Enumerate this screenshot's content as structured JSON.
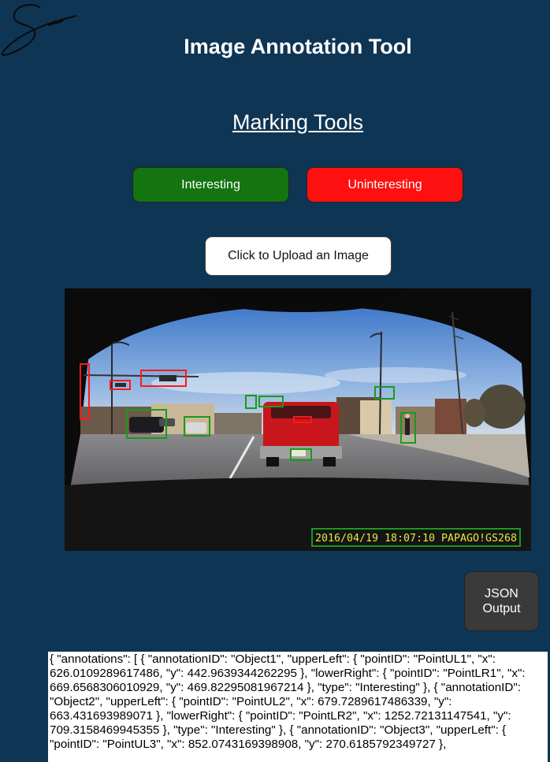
{
  "app": {
    "title": "Image Annotation Tool"
  },
  "tools": {
    "heading": "Marking Tools",
    "interesting_label": "Interesting",
    "uninteresting_label": "Uninteresting",
    "interesting_color": "#137411",
    "uninteresting_color": "#fe1010"
  },
  "upload": {
    "label": "Click to Upload an Image"
  },
  "image": {
    "timestamp": "2016/04/19 18:07:10 PAPAGO!GS268",
    "annotation_types": [
      "Interesting",
      "Uninteresting"
    ]
  },
  "json_button": {
    "label": "JSON\nOutput"
  },
  "json_output": {
    "text": "{ \"annotations\": [ { \"annotationID\": \"Object1\", \"upperLeft\": { \"pointID\": \"PointUL1\", \"x\": 626.0109289617486, \"y\": 442.9639344262295 }, \"lowerRight\": { \"pointID\": \"PointLR1\", \"x\": 669.6568306010929, \"y\": 469.82295081967214 }, \"type\": \"Interesting\" }, { \"annotationID\": \"Object2\", \"upperLeft\": { \"pointID\": \"PointUL2\", \"x\": 679.7289617486339, \"y\": 663.431693989071 }, \"lowerRight\": { \"pointID\": \"PointLR2\", \"x\": 1252.72131147541, \"y\": 709.3158469945355 }, \"type\": \"Interesting\" }, { \"annotationID\": \"Object3\", \"upperLeft\": { \"pointID\": \"PointUL3\", \"x\": 852.0743169398908, \"y\": 270.6185792349727 },"
  }
}
